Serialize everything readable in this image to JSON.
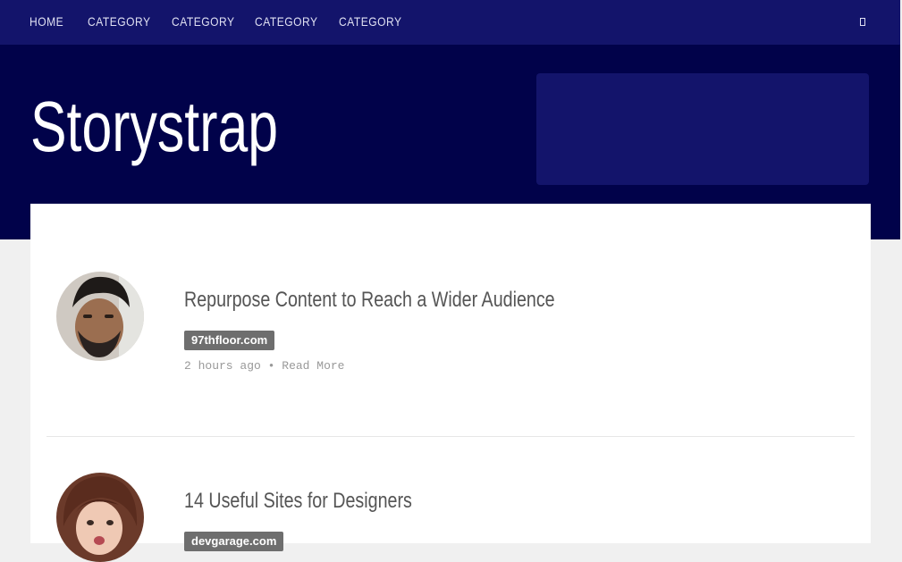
{
  "nav": {
    "items": [
      {
        "label": "HOME"
      },
      {
        "label": "CATEGORY"
      },
      {
        "label": "CATEGORY"
      },
      {
        "label": "CATEGORY"
      },
      {
        "label": "CATEGORY"
      }
    ],
    "search_icon": "search-icon"
  },
  "header": {
    "site_title": "Storystrap"
  },
  "posts": [
    {
      "title": "Repurpose Content to Reach a Wider Audience",
      "source": "97thfloor.com",
      "time": "2 hours ago",
      "separator": "•",
      "read_more": "Read More"
    },
    {
      "title": "14 Useful Sites for Designers",
      "source": "devgarage.com"
    }
  ],
  "colors": {
    "navbar": "#13146b",
    "hero": "#01024a",
    "page_background": "#f0f0f0",
    "badge": "#6e6e6e"
  }
}
